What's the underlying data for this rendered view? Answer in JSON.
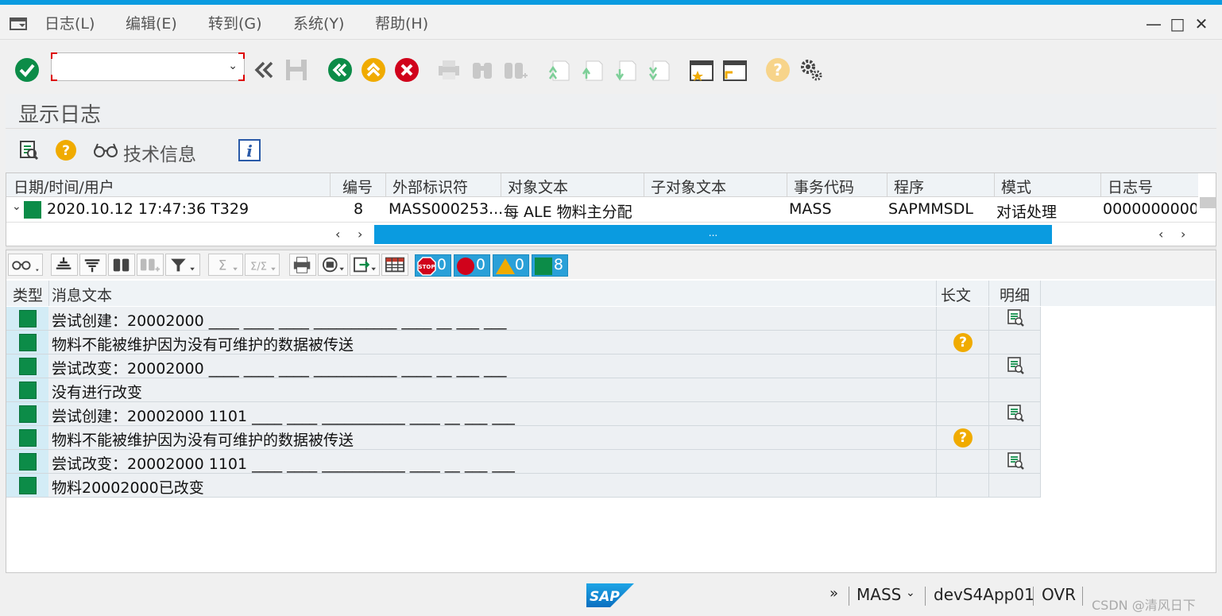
{
  "window": {
    "menu": [
      "日志(L)",
      "编辑(E)",
      "转到(G)",
      "系统(Y)",
      "帮助(H)"
    ],
    "min_label": "—",
    "max_label": "□",
    "close_label": "✕"
  },
  "command_field": {
    "value": "",
    "placeholder": ""
  },
  "page_title": "显示日志",
  "app_toolbar": {
    "tech_info_label": "技术信息"
  },
  "log_header": {
    "columns": [
      "日期/时间/用户",
      "编号",
      "外部标识符",
      "对象文本",
      "子对象文本",
      "事务代码",
      "程序",
      "模式",
      "日志号"
    ],
    "row": {
      "datetime_user": "2020.10.12  17:47:36  T329",
      "number": "8",
      "external_id": "MASS000253...",
      "object_text": "每 ALE 物料主分配",
      "subobject_text": "",
      "tcode": "MASS",
      "program": "SAPMMSDL",
      "mode": "对话处理",
      "log_number": "0000000000(",
      "scroll_thumb_label": "..."
    }
  },
  "counters": {
    "stop": "0",
    "error": "0",
    "warning": "0",
    "success": "8"
  },
  "messages": {
    "columns": {
      "type": "类型",
      "text": "消息文本",
      "long_text": "长文",
      "detail": "明细"
    },
    "rows": [
      {
        "text": "尝试创建：20002000 ____ ____ ____ ___________ ____ __ ___ ___",
        "long_text": false,
        "detail": true
      },
      {
        "text": "物料不能被维护因为没有可维护的数据被传送",
        "long_text": true,
        "detail": false
      },
      {
        "text": "尝试改变：20002000 ____ ____ ____ ___________ ____ __ ___ ___",
        "long_text": false,
        "detail": true
      },
      {
        "text": "没有进行改变",
        "long_text": false,
        "detail": false
      },
      {
        "text": "尝试创建：20002000 1101 ____ ____ ___________ ____ __ ___ ___",
        "long_text": false,
        "detail": true
      },
      {
        "text": "物料不能被维护因为没有可维护的数据被传送",
        "long_text": true,
        "detail": false
      },
      {
        "text": "尝试改变：20002000 1101 ____ ____ ___________ ____ __ ___ ___",
        "long_text": false,
        "detail": true
      },
      {
        "text": "物料20002000已改变",
        "long_text": false,
        "detail": false
      }
    ]
  },
  "status_bar": {
    "logo": "SAP",
    "expand": "»",
    "transaction": "MASS",
    "server": "devS4App01",
    "mode": "OVR",
    "watermark": "CSDN @清风日下"
  },
  "colors": {
    "accent": "#0a9be0",
    "success": "#0c8c48",
    "help": "#f0ab00",
    "stop": "#d0021b"
  }
}
